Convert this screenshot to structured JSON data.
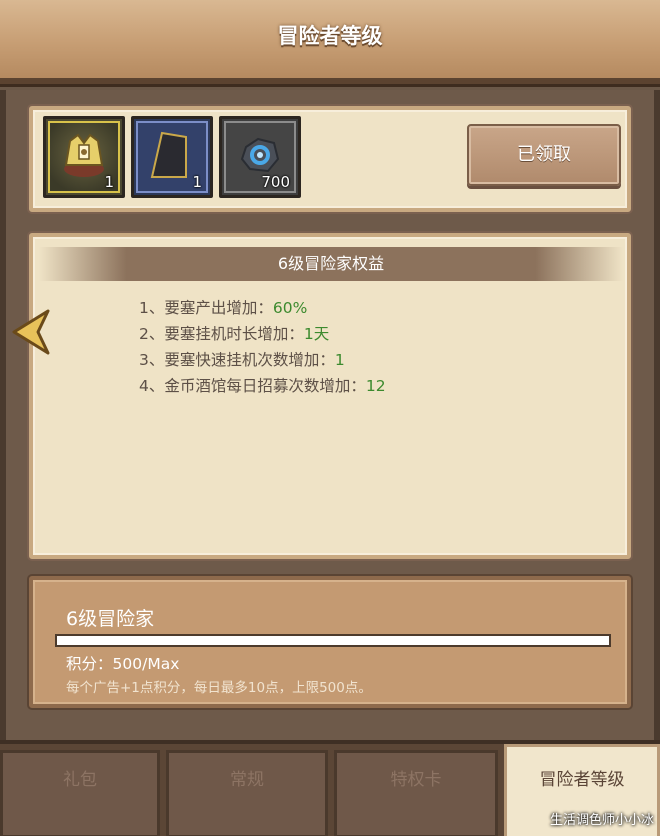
{
  "header": {
    "title": "冒险者等级"
  },
  "rewards": {
    "items": [
      {
        "icon": "golden-helmet-icon",
        "count": "1"
      },
      {
        "icon": "dark-cloak-icon",
        "count": "1"
      },
      {
        "icon": "blue-gem-stone-icon",
        "count": "700"
      }
    ],
    "claim_button_label": "已领取"
  },
  "benefits": {
    "title": "6级冒险家权益",
    "rows": [
      {
        "text": "1、要塞产出增加：",
        "value": "60%"
      },
      {
        "text": "2、要塞挂机时长增加：",
        "value": "1天"
      },
      {
        "text": "3、要塞快速挂机次数增加：",
        "value": "1"
      },
      {
        "text": "4、金币酒馆每日招募次数增加：",
        "value": "12"
      }
    ]
  },
  "level": {
    "title": "6级冒险家",
    "progress_fraction": 1.0,
    "score_label": "积分：",
    "score_value": "500/Max",
    "hint": "每个广告+1点积分，每日最多10点，上限500点。"
  },
  "tabs": [
    {
      "label": "礼包",
      "active": false
    },
    {
      "label": "常规",
      "active": false
    },
    {
      "label": "特权卡",
      "active": false
    },
    {
      "label": "冒险者等级",
      "active": true
    }
  ],
  "watermark": "生活调色师小小冰",
  "colors": {
    "benefit_value_green": "#3c8a2e",
    "header_wood": "#c79e74",
    "panel_parchment": "#efe3c6"
  }
}
